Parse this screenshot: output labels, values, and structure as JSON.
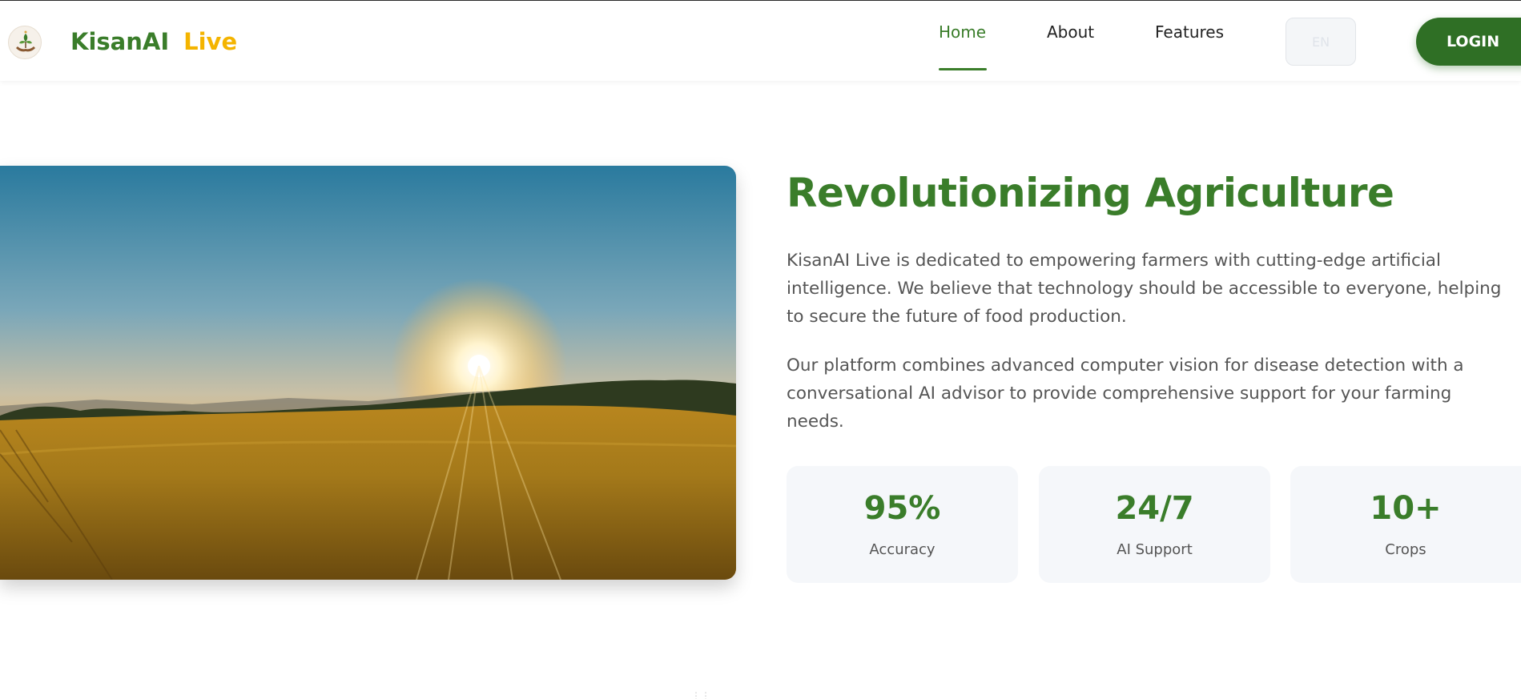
{
  "header": {
    "brand": {
      "name": "KisanAI",
      "accent": "Live"
    },
    "nav": [
      {
        "label": "Home",
        "active": true
      },
      {
        "label": "About",
        "active": false
      },
      {
        "label": "Features",
        "active": false
      }
    ],
    "language": "EN",
    "login_label": "LOGIN"
  },
  "hero": {
    "image_icon": "wheat-field-sunset-image",
    "title": "Revolutionizing Agriculture",
    "paragraphs": [
      "KisanAI Live is dedicated to empowering farmers with cutting-edge artificial intelligence. We believe that technology should be accessible to everyone, helping to secure the future of food production.",
      "Our platform combines advanced computer vision for disease detection with a conversational AI advisor to provide comprehensive support for your farming needs."
    ],
    "stats": [
      {
        "value": "95%",
        "label": "Accuracy"
      },
      {
        "value": "24/7",
        "label": "AI Support"
      },
      {
        "value": "10+",
        "label": "Crops"
      }
    ]
  },
  "colors": {
    "primary_green": "#3a7d2a",
    "accent_yellow": "#f4b400",
    "button_green": "#2f6f25",
    "stat_background": "#f5f7fa"
  },
  "icons": {
    "logo": "hands-plant-logo-icon",
    "scroll": "scroll-indicator-icon"
  }
}
